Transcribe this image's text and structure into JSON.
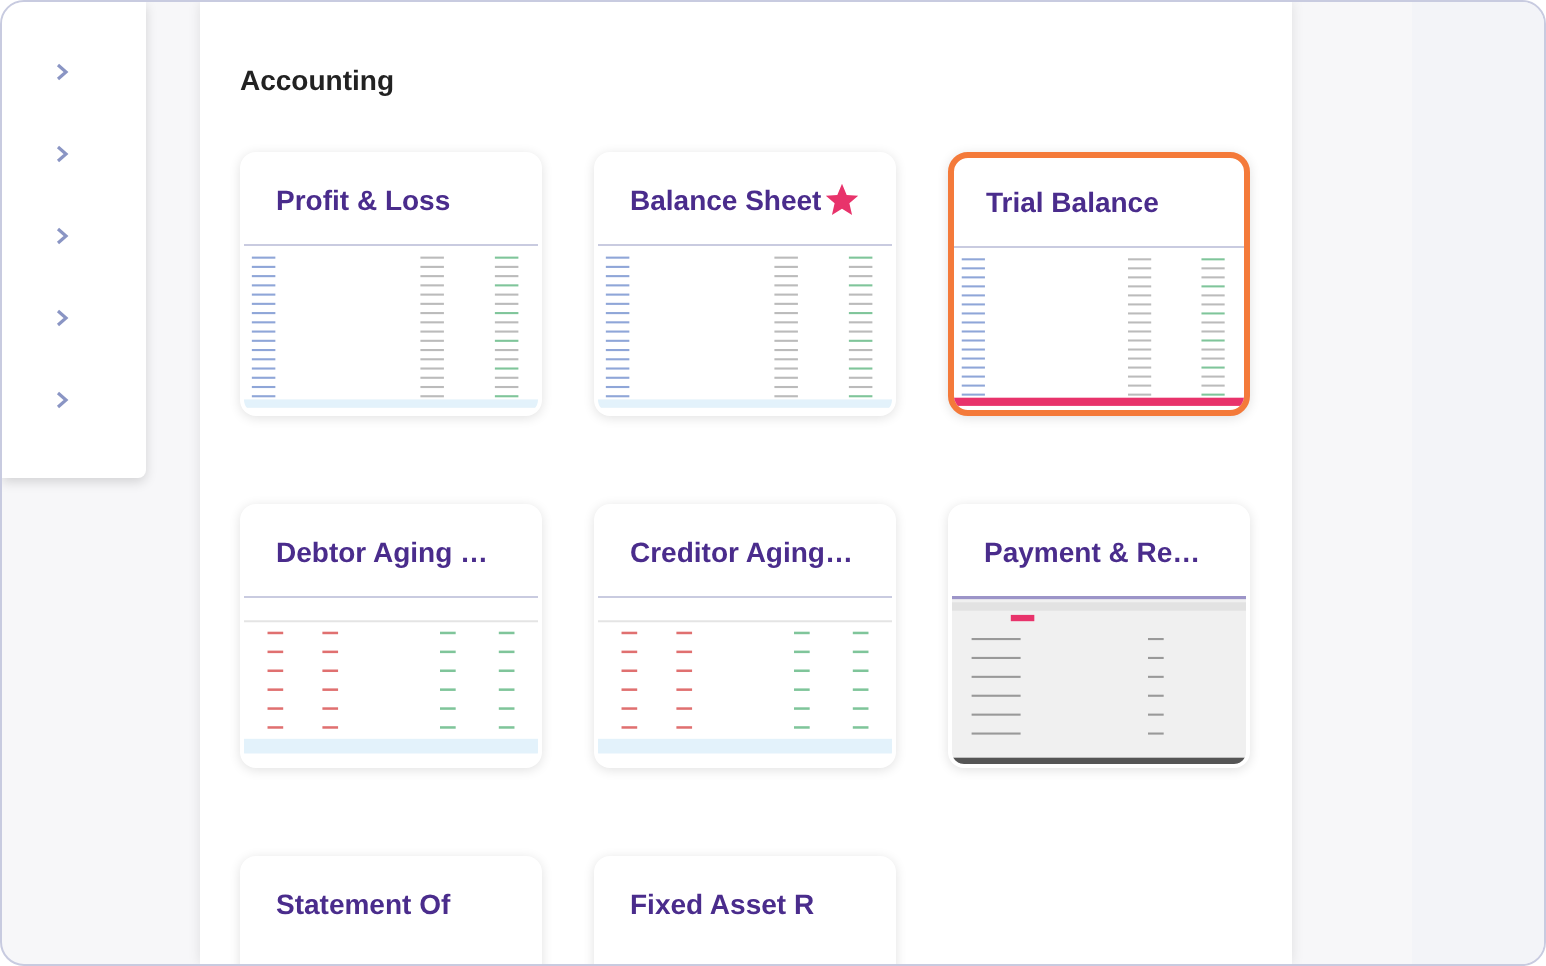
{
  "sidebar": {
    "items": [
      {
        "kind": "chevron"
      },
      {
        "kind": "chevron"
      },
      {
        "kind": "chevron"
      },
      {
        "kind": "chevron"
      },
      {
        "kind": "chevron"
      }
    ]
  },
  "section": {
    "title": "Accounting"
  },
  "cards": [
    {
      "title": "Profit & Loss",
      "selected": false,
      "favorite": false,
      "kind": "report"
    },
    {
      "title": "Balance Sheet",
      "selected": false,
      "favorite": true,
      "kind": "report"
    },
    {
      "title": "Trial Balance",
      "selected": true,
      "favorite": false,
      "kind": "totals"
    },
    {
      "title": "Debtor Aging …",
      "selected": false,
      "favorite": false,
      "kind": "aging"
    },
    {
      "title": "Creditor Aging…",
      "selected": false,
      "favorite": false,
      "kind": "aging"
    },
    {
      "title": "Payment & Re…",
      "selected": false,
      "favorite": false,
      "kind": "screen"
    },
    {
      "title": "Statement Of",
      "selected": false,
      "favorite": false,
      "kind": "cut"
    },
    {
      "title": "Fixed Asset R",
      "selected": false,
      "favorite": false,
      "kind": "cut"
    }
  ]
}
